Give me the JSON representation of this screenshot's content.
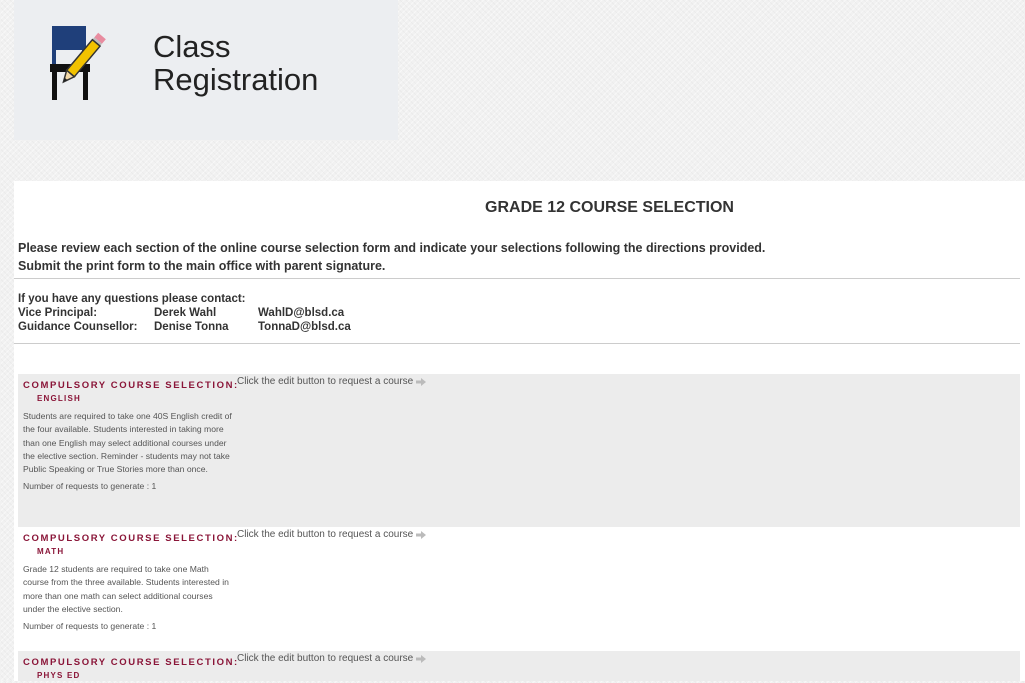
{
  "logo": {
    "line1": "Class",
    "line2": "Registration"
  },
  "page": {
    "title": "GRADE 12 COURSE SELECTION",
    "intro_line1": "Please review each section of the online course selection form and indicate your selections following the directions provided.",
    "intro_line2": "Submit the print form to the main office with parent signature."
  },
  "contacts": {
    "heading": "If you have any questions please contact:",
    "rows": [
      {
        "role": "Vice Principal:",
        "name": "Derek Wahl",
        "email": "WahlD@blsd.ca"
      },
      {
        "role": "Guidance Counsellor:",
        "name": "Denise Tonna",
        "email": "TonnaD@blsd.ca"
      }
    ]
  },
  "sections": [
    {
      "heading": "Compulsory Course Selection:",
      "subject": "English",
      "description": "Students are required to take one 40S English credit of the four available. Students interested in taking more than one English may select additional courses under the elective section. Reminder - students may not take Public Speaking or True Stories more than once.",
      "requests": "Number of requests to generate : 1",
      "action": "Click the edit button to request a course"
    },
    {
      "heading": "Compulsory Course Selection:",
      "subject": "Math",
      "description": "Grade 12 students are required to take one Math course from the three available. Students interested in more than one math can select additional courses under the elective section.",
      "requests": "Number of requests to generate : 1",
      "action": "Click the edit button to request a course"
    },
    {
      "heading": "Compulsory Course Selection:",
      "subject": "Phys Ed",
      "action": "Click the edit button to request a course"
    }
  ],
  "colors": {
    "section_heading": "#8a1538",
    "shaded_row": "#ececec",
    "logo_chair": "#1f3f7a",
    "logo_pencil": "#f2c200"
  },
  "icons": {
    "logo": "chair-pencil-icon",
    "action": "arrow-right-icon"
  }
}
